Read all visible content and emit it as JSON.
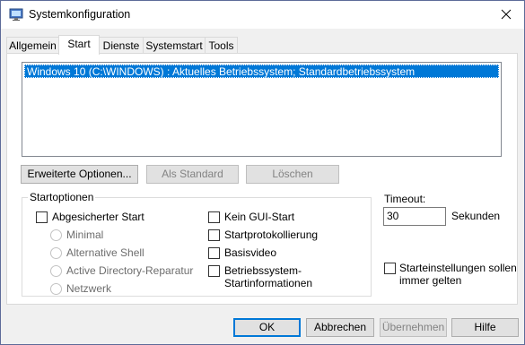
{
  "window": {
    "title": "Systemkonfiguration"
  },
  "tabs": [
    "Allgemein",
    "Start",
    "Dienste",
    "Systemstart",
    "Tools"
  ],
  "active_tab": "Start",
  "os_list": [
    "Windows 10 (C:\\WINDOWS) : Aktuelles Betriebssystem; Standardbetriebssystem"
  ],
  "buttons": {
    "advanced": "Erweiterte Optionen...",
    "set_default": "Als Standard",
    "delete": "Löschen"
  },
  "boot_options": {
    "title": "Startoptionen",
    "safe_boot": "Abgesicherter Start",
    "radios": [
      "Minimal",
      "Alternative Shell",
      "Active Directory-Reparatur",
      "Netzwerk"
    ],
    "no_gui": "Kein GUI-Start",
    "boot_log": "Startprotokollierung",
    "base_video": "Basisvideo",
    "os_info_line1": "Betriebssystem-",
    "os_info_line2": "Startinformationen"
  },
  "timeout": {
    "label": "Timeout:",
    "value": "30",
    "unit": "Sekunden"
  },
  "permanent": {
    "line1": "Starteinstellungen sollen",
    "line2": "immer gelten"
  },
  "footer": {
    "ok": "OK",
    "cancel": "Abbrechen",
    "apply": "Übernehmen",
    "help": "Hilfe"
  },
  "colors": {
    "selection": "#0078d7",
    "disabled_text": "#838383"
  }
}
